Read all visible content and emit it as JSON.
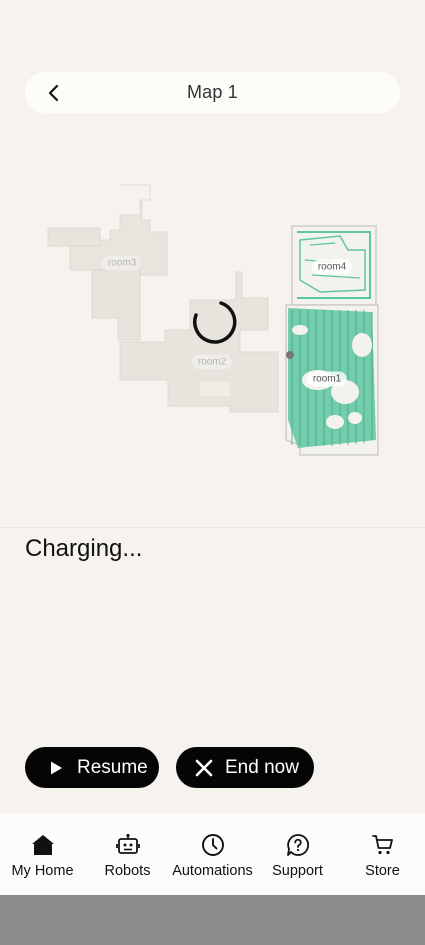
{
  "header": {
    "title": "Map 1",
    "back_icon": "chevron-left-icon"
  },
  "map": {
    "rooms": [
      {
        "id": "room3",
        "label": "room3"
      },
      {
        "id": "room4",
        "label": "room4"
      },
      {
        "id": "room2",
        "label": "room2"
      },
      {
        "id": "room1",
        "label": "room1"
      }
    ],
    "cleaned_color": "#5cc7a0",
    "floor_color": "#e7e4dd",
    "wall_color": "#cfccc6",
    "loading_icon": "spinner-icon"
  },
  "status": {
    "text": "Charging..."
  },
  "actions": {
    "resume_label": "Resume",
    "end_label": "End now"
  },
  "nav": {
    "items": [
      {
        "label": "My Home",
        "icon": "home-icon"
      },
      {
        "label": "Robots",
        "icon": "robot-icon"
      },
      {
        "label": "Automations",
        "icon": "clock-icon"
      },
      {
        "label": "Support",
        "icon": "help-circle-icon"
      },
      {
        "label": "Store",
        "icon": "cart-icon"
      }
    ]
  },
  "colors": {
    "background": "#f6f3ef",
    "button_bg": "#050505",
    "button_text": "#ffffff",
    "system_bar": "#8f8d8b"
  }
}
